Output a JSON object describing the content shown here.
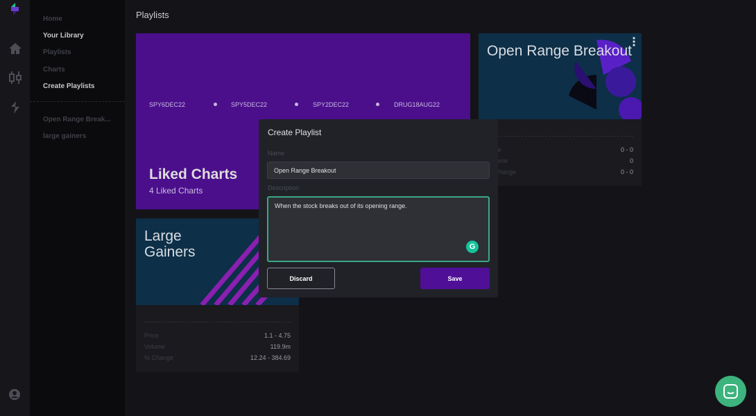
{
  "rail": {
    "icons": [
      "logo-icon",
      "home-icon",
      "candlestick-icon",
      "bolt-icon",
      "account-icon"
    ]
  },
  "sidebar": {
    "items": [
      {
        "label": "Home",
        "active": false
      },
      {
        "label": "Your Library",
        "active": true
      },
      {
        "label": "Playlists",
        "active": false
      },
      {
        "label": "Charts",
        "active": false
      },
      {
        "label": "Create Playlists",
        "active": true
      }
    ],
    "playlists": [
      "Open Range Break...",
      "large gainers"
    ]
  },
  "page": {
    "title": "Playlists"
  },
  "liked": {
    "tickers": [
      "SPY6DEC22",
      "SPY5DEC22",
      "SPY2DEC22",
      "DRUG18AUG22"
    ],
    "title": "Liked Charts",
    "subtitle": "4 Liked Charts",
    "color": "#4b0f8c"
  },
  "cards": [
    {
      "name": "Open Range Breakout",
      "stats": [
        {
          "label": "Price",
          "value": "0 - 0"
        },
        {
          "label": "Volume",
          "value": "0"
        },
        {
          "label": "% Change",
          "value": "0 - 0"
        }
      ]
    },
    {
      "name": "Large Gainers",
      "stats": [
        {
          "label": "Price",
          "value": "1.1 - 4.75"
        },
        {
          "label": "Volume",
          "value": "119.9m"
        },
        {
          "label": "% Change",
          "value": "12.24 - 384.69"
        }
      ]
    }
  ],
  "modal": {
    "title": "Create Playlist",
    "name_label": "Name",
    "name_value": "Open Range Breakout",
    "desc_label": "Description",
    "desc_value": "When the stock breaks out of its opening range.",
    "discard": "Discard",
    "save": "Save",
    "accent": "#4f0f97"
  }
}
